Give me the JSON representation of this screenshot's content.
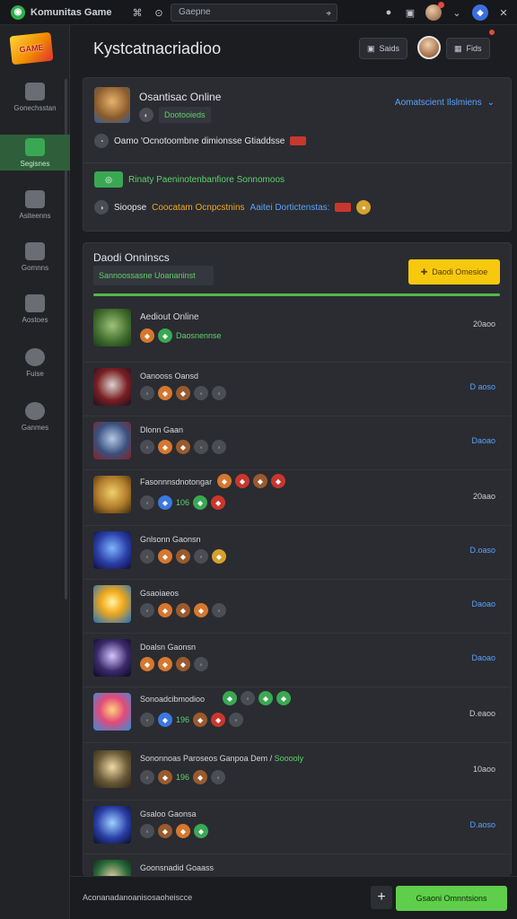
{
  "topbar": {
    "app_title": "Komunitas Game",
    "search_value": "Gaepne",
    "icons": [
      "back-icon",
      "refresh-icon",
      "search-icon",
      "target-icon",
      "square-icon",
      "avatar",
      "chevron-icon",
      "notification-icon",
      "close-icon"
    ]
  },
  "sidebar": {
    "items": [
      {
        "label": "Gonechsstan",
        "icon": "puzzle-icon"
      },
      {
        "label": "Segisnes",
        "icon": "home-icon"
      },
      {
        "label": "Asiteenns",
        "icon": "tools-icon"
      },
      {
        "label": "Gomnns",
        "icon": "store-icon"
      },
      {
        "label": "Aostoes",
        "icon": "gear-icon"
      },
      {
        "label": "Fuise",
        "icon": "profile-icon"
      },
      {
        "label": "Ganmes",
        "icon": "compass-icon"
      }
    ]
  },
  "header": {
    "title": "Kystcatnacriadioo",
    "btn1": "Saids",
    "btn2": "Fids"
  },
  "card1": {
    "game_title": "Osantisac Online",
    "tag": "Dootooieds",
    "dropdown_label": "Aomatscient Ilslmiens",
    "line1": "Oamo 'Ocnotoombne dimionsse Gtiaddsse",
    "line2_green": "Rinaty Paeninotenbanfiore Sonnomoos",
    "line3_prefix": "Sioopse",
    "line3_orange": "Coocatam Ocnpcstnins",
    "line3_blue": "Aaitei Dortictenstas:"
  },
  "card2": {
    "title": "Daodi Onninscs",
    "search_placeholder": "Sannoossasne Uoananinst",
    "yellow_btn": "Daodi Omesioe",
    "rows": [
      {
        "title": "Aediout Online",
        "sub": "Daosnennse",
        "time": "20aoo",
        "time_blue": false
      },
      {
        "title": "Oanooss Oansd",
        "time": "D aoso",
        "time_blue": true
      },
      {
        "title": "Dlonn Gaan",
        "time": "Daoao",
        "time_blue": true
      },
      {
        "title": "Fasonnnsdnotongar",
        "sub": "106",
        "time": "20aao",
        "time_blue": false
      },
      {
        "title": "Gnlsonn Gaonsn",
        "time": "D.oaso",
        "time_blue": true
      },
      {
        "title": "Gsaoiaeos",
        "time": "Daoao",
        "time_blue": true
      },
      {
        "title": "Doalsn Gaonsn",
        "time": "Daoao",
        "time_blue": true
      },
      {
        "title": "Sonoadcibmodioo",
        "sub": "196",
        "time": "D.eaoo",
        "time_blue": false
      },
      {
        "title": "Sononnoas Paroseos Ganpoa Dem /",
        "green": "Sooooly",
        "sub": "196",
        "time": "10aoo",
        "time_blue": false
      },
      {
        "title": "Gsaloo Gaonsa",
        "time": "D.aoso",
        "time_blue": true
      },
      {
        "title": "Goonsnadid Goaass",
        "time": "",
        "time_blue": false
      }
    ]
  },
  "footer": {
    "text": "Aconanadanoanisosaoheiscce",
    "plus": "+",
    "green_btn": "Gsaoni Omnntsions"
  },
  "colors": {
    "accent_green": "#5fce4a",
    "accent_blue": "#5aa2ff",
    "accent_yellow": "#f6c90e",
    "background": "#1c1d21"
  }
}
